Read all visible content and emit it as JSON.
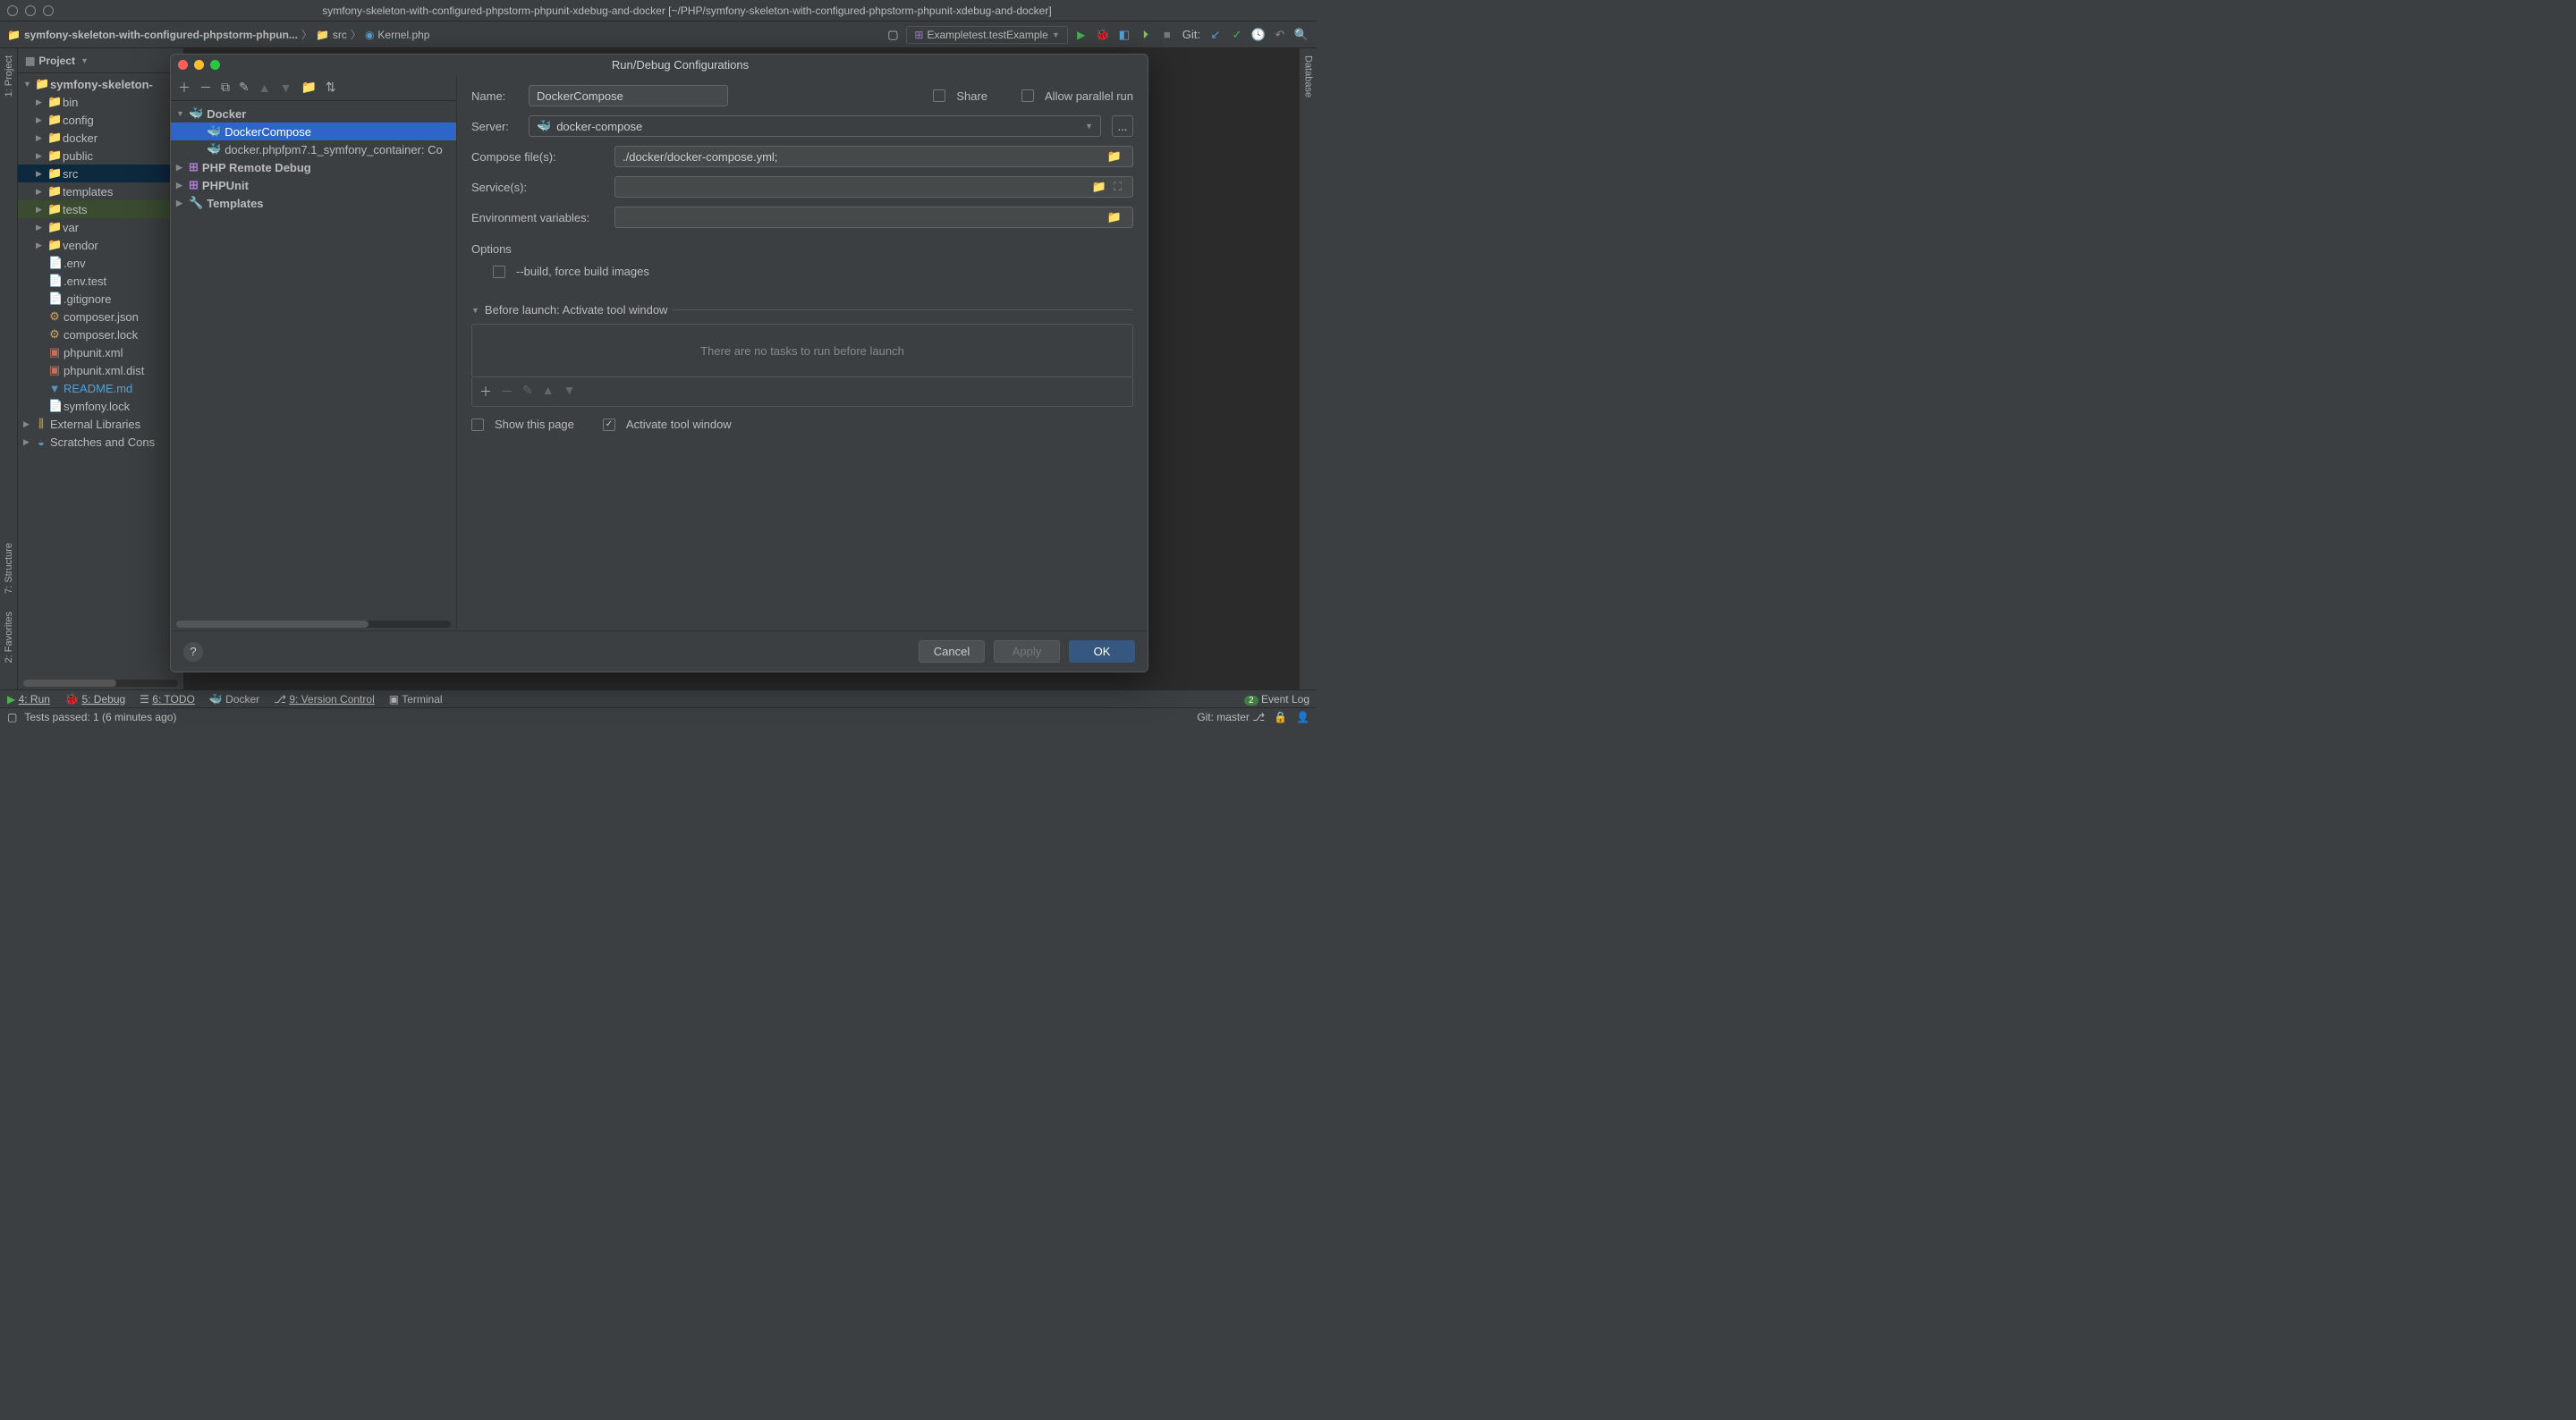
{
  "title": "symfony-skeleton-with-configured-phpstorm-phpunit-xdebug-and-docker [~/PHP/symfony-skeleton-with-configured-phpstorm-phpunit-xdebug-and-docker]",
  "breadcrumb": {
    "root": "symfony-skeleton-with-configured-phpstorm-phpun...",
    "src": "src",
    "file": "Kernel.php"
  },
  "toolbar": {
    "run_config": "Exampletest.testExample",
    "git_label": "Git:"
  },
  "left_tabs": {
    "project": "1: Project",
    "structure": "7: Structure",
    "favorites": "2: Favorites"
  },
  "right_tabs": {
    "database": "Database"
  },
  "project": {
    "header": "Project",
    "root": "symfony-skeleton-",
    "items": [
      {
        "name": "bin",
        "type": "folder"
      },
      {
        "name": "config",
        "type": "folder"
      },
      {
        "name": "docker",
        "type": "folder"
      },
      {
        "name": "public",
        "type": "folder"
      },
      {
        "name": "src",
        "type": "src"
      },
      {
        "name": "templates",
        "type": "folder"
      },
      {
        "name": "tests",
        "type": "tests"
      },
      {
        "name": "var",
        "type": "folder"
      },
      {
        "name": "vendor",
        "type": "folder"
      },
      {
        "name": ".env",
        "type": "file"
      },
      {
        "name": ".env.test",
        "type": "file"
      },
      {
        "name": ".gitignore",
        "type": "file"
      },
      {
        "name": "composer.json",
        "type": "json"
      },
      {
        "name": "composer.lock",
        "type": "json"
      },
      {
        "name": "phpunit.xml",
        "type": "xml"
      },
      {
        "name": "phpunit.xml.dist",
        "type": "xml"
      },
      {
        "name": "README.md",
        "type": "md"
      },
      {
        "name": "symfony.lock",
        "type": "file"
      }
    ],
    "external": "External Libraries",
    "scratches": "Scratches and Cons"
  },
  "dialog": {
    "title": "Run/Debug Configurations",
    "tree": {
      "docker": "Docker",
      "docker_compose": "DockerCompose",
      "docker_phpfpm": "docker.phpfpm7.1_symfony_container: Co",
      "php_remote": "PHP Remote Debug",
      "phpunit": "PHPUnit",
      "templates": "Templates"
    },
    "form": {
      "name_label": "Name:",
      "name_value": "DockerCompose",
      "share": "Share",
      "allow_parallel": "Allow parallel run",
      "server_label": "Server:",
      "server_value": "docker-compose",
      "dots": "...",
      "compose_label": "Compose file(s):",
      "compose_value": "./docker/docker-compose.yml;",
      "services_label": "Service(s):",
      "env_label": "Environment variables:",
      "options_title": "Options",
      "build_flag": "--build, force build images",
      "before_launch": "Before launch: Activate tool window",
      "no_tasks": "There are no tasks to run before launch",
      "show_page": "Show this page",
      "activate_tw": "Activate tool window"
    },
    "footer": {
      "cancel": "Cancel",
      "apply": "Apply",
      "ok": "OK"
    }
  },
  "bottombar": {
    "run": "4: Run",
    "debug": "5: Debug",
    "todo": "6: TODO",
    "docker": "Docker",
    "vc": "9: Version Control",
    "terminal": "Terminal",
    "event_log": "Event Log",
    "event_count": "2"
  },
  "status": {
    "tests": "Tests passed: 1 (6 minutes ago)",
    "git_branch": "Git: master"
  }
}
